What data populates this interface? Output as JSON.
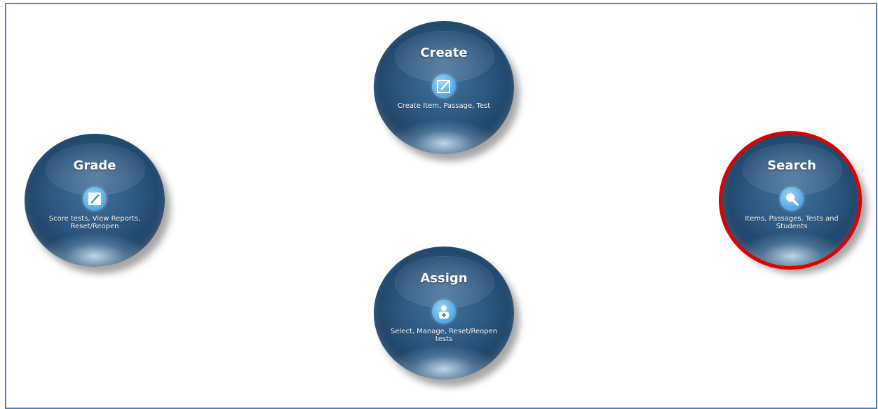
{
  "actions": {
    "create": {
      "title": "Create",
      "description": "Create Item, Passage, Test",
      "icon": "edit-square-icon"
    },
    "grade": {
      "title": "Grade",
      "description": "Score tests, View Reports, Reset/Reopen",
      "icon": "pencil-icon"
    },
    "search": {
      "title": "Search",
      "description": "Items, Passages, Tests and Students",
      "icon": "magnifier-icon",
      "highlighted": true
    },
    "assign": {
      "title": "Assign",
      "description": "Select, Manage, Reset/Reopen tests",
      "icon": "add-user-icon"
    }
  },
  "colors": {
    "orb": "#2f5c86",
    "icon": "#5aaee8",
    "highlight": "#e00000",
    "frame": "#4f81bd"
  }
}
